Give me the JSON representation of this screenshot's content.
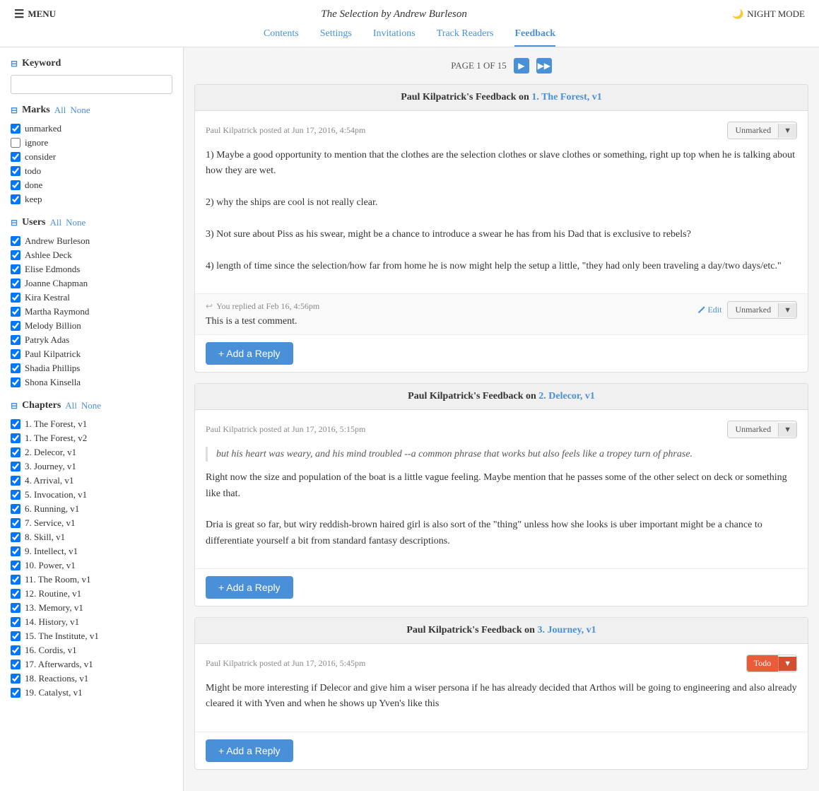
{
  "header": {
    "menu_label": "MENU",
    "book_title": "The Selection",
    "book_author": "Andrew Burleson",
    "night_mode_label": "NIGHT MODE",
    "nav_tabs": [
      {
        "id": "contents",
        "label": "Contents"
      },
      {
        "id": "settings",
        "label": "Settings"
      },
      {
        "id": "invitations",
        "label": "Invitations"
      },
      {
        "id": "track_readers",
        "label": "Track Readers"
      },
      {
        "id": "feedback",
        "label": "Feedback",
        "active": true
      }
    ]
  },
  "sidebar": {
    "keyword_section": {
      "title": "Keyword",
      "placeholder": ""
    },
    "marks_section": {
      "title": "Marks",
      "all_label": "All",
      "none_label": "None",
      "items": [
        {
          "label": "unmarked",
          "checked": true
        },
        {
          "label": "ignore",
          "checked": false
        },
        {
          "label": "consider",
          "checked": true
        },
        {
          "label": "todo",
          "checked": true
        },
        {
          "label": "done",
          "checked": true
        },
        {
          "label": "keep",
          "checked": true
        }
      ]
    },
    "users_section": {
      "title": "Users",
      "all_label": "All",
      "none_label": "None",
      "items": [
        {
          "label": "Andrew Burleson",
          "checked": true
        },
        {
          "label": "Ashlee Deck",
          "checked": true
        },
        {
          "label": "Elise Edmonds",
          "checked": true
        },
        {
          "label": "Joanne Chapman",
          "checked": true
        },
        {
          "label": "Kira Kestral",
          "checked": true
        },
        {
          "label": "Martha Raymond",
          "checked": true
        },
        {
          "label": "Melody Billion",
          "checked": true
        },
        {
          "label": "Patryk Adas",
          "checked": true
        },
        {
          "label": "Paul Kilpatrick",
          "checked": true
        },
        {
          "label": "Shadia Phillips",
          "checked": true
        },
        {
          "label": "Shona Kinsella",
          "checked": true
        }
      ]
    },
    "chapters_section": {
      "title": "Chapters",
      "all_label": "All",
      "none_label": "None",
      "items": [
        {
          "label": "1. The Forest, v1",
          "checked": true
        },
        {
          "label": "1. The Forest, v2",
          "checked": true
        },
        {
          "label": "2. Delecor, v1",
          "checked": true
        },
        {
          "label": "3. Journey, v1",
          "checked": true
        },
        {
          "label": "4. Arrival, v1",
          "checked": true
        },
        {
          "label": "5. Invocation, v1",
          "checked": true
        },
        {
          "label": "6. Running, v1",
          "checked": true
        },
        {
          "label": "7. Service, v1",
          "checked": true
        },
        {
          "label": "8. Skill, v1",
          "checked": true
        },
        {
          "label": "9. Intellect, v1",
          "checked": true
        },
        {
          "label": "10. Power, v1",
          "checked": true
        },
        {
          "label": "11. The Room, v1",
          "checked": true
        },
        {
          "label": "12. Routine, v1",
          "checked": true
        },
        {
          "label": "13. Memory, v1",
          "checked": true
        },
        {
          "label": "14. History, v1",
          "checked": true
        },
        {
          "label": "15. The Institute, v1",
          "checked": true
        },
        {
          "label": "16. Cordis, v1",
          "checked": true
        },
        {
          "label": "17. Afterwards, v1",
          "checked": true
        },
        {
          "label": "18. Reactions, v1",
          "checked": true
        },
        {
          "label": "19. Catalyst, v1",
          "checked": true
        }
      ]
    }
  },
  "main": {
    "pagination": {
      "text": "PAGE 1 OF 15"
    },
    "feedback_cards": [
      {
        "id": "card1",
        "header_author": "Paul Kilpatrick's Feedback on ",
        "header_chapter": "1. The Forest, v1",
        "post_meta": "Paul Kilpatrick posted at Jun 17, 2016, 4:54pm",
        "mark_label": "Unmarked",
        "content": "1) Maybe a good opportunity to mention that the clothes are the selection clothes or slave clothes or something, right up top when he is talking about how they are wet.\n\n2) why the ships are cool is not really clear.\n\n3) Not sure about Piss as his swear, might be a chance to introduce a swear he has from his Dad that is exclusive to rebels?\n\n4) length of time since the selection/how far from home he is now might help the setup a little, \"they had only been traveling a day/two days/etc.\"",
        "has_reply": true,
        "reply_meta": "You replied at Feb 16, 4:56pm",
        "reply_text": "This is a test comment.",
        "reply_mark_label": "Unmarked",
        "add_reply_label": "+ Add a Reply"
      },
      {
        "id": "card2",
        "header_author": "Paul Kilpatrick's Feedback on ",
        "header_chapter": "2. Delecor, v1",
        "post_meta": "Paul Kilpatrick posted at Jun 17, 2016, 5:15pm",
        "mark_label": "Unmarked",
        "quoted_text": "but his heart was weary, and his mind troubled --a common phrase that works but also feels like a tropey turn of phrase.",
        "content": "Right now the size and population of the boat is a little vague feeling. Maybe mention that he passes some of the other select on deck or something like that.\n\nDria is great so far, but wiry reddish-brown haired girl is also sort of the \"thing\" unless how she looks is uber important might be a chance to differentiate yourself a bit from standard fantasy descriptions.",
        "has_reply": false,
        "add_reply_label": "+ Add a Reply"
      },
      {
        "id": "card3",
        "header_author": "Paul Kilpatrick's Feedback on ",
        "header_chapter": "3. Journey, v1",
        "post_meta": "Paul Kilpatrick posted at Jun 17, 2016, 5:45pm",
        "mark_label": "Todo",
        "mark_style": "todo",
        "content": "Might be more interesting if Delecor and give him a wiser persona if he has already decided that Arthos will be going to engineering and also already cleared it with Yven and when he shows up Yven's like this",
        "has_reply": false,
        "add_reply_label": "+ Add a Reply"
      }
    ]
  }
}
